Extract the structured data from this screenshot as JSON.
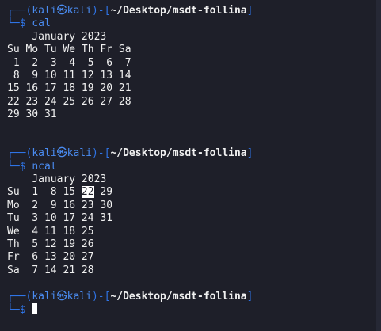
{
  "prompt": {
    "corner_top": "┌──(",
    "user": "kali",
    "at": "㉿",
    "host": "kali",
    "close_paren": ")-[",
    "path": "~/Desktop/msdt-follina",
    "close_bracket": "]",
    "corner_bottom": "└─",
    "dollar": "$"
  },
  "blocks": [
    {
      "command": "cal",
      "output": [
        "    January 2023",
        "Su Mo Tu We Th Fr Sa",
        " 1  2  3  4  5  6  7",
        " 8  9 10 11 12 13 14",
        "15 16 17 18 19 20 21",
        "22 23 24 25 26 27 28",
        "29 30 31"
      ]
    },
    {
      "command": "ncal",
      "output": [
        "    January 2023",
        "Su  1  8 15 |22| 29",
        "Mo  2  9 16 23 30",
        "Tu  3 10 17 24 31",
        "We  4 11 18 25",
        "Th  5 12 19 26",
        "Fr  6 13 20 27",
        "Sa  7 14 21 28"
      ],
      "highlight_day": "22"
    }
  ],
  "colors": {
    "background": "#1e1f29",
    "prompt_blue": "#4a8bf0",
    "frame_blue": "#2f74e6",
    "text": "#f0f0f0"
  }
}
